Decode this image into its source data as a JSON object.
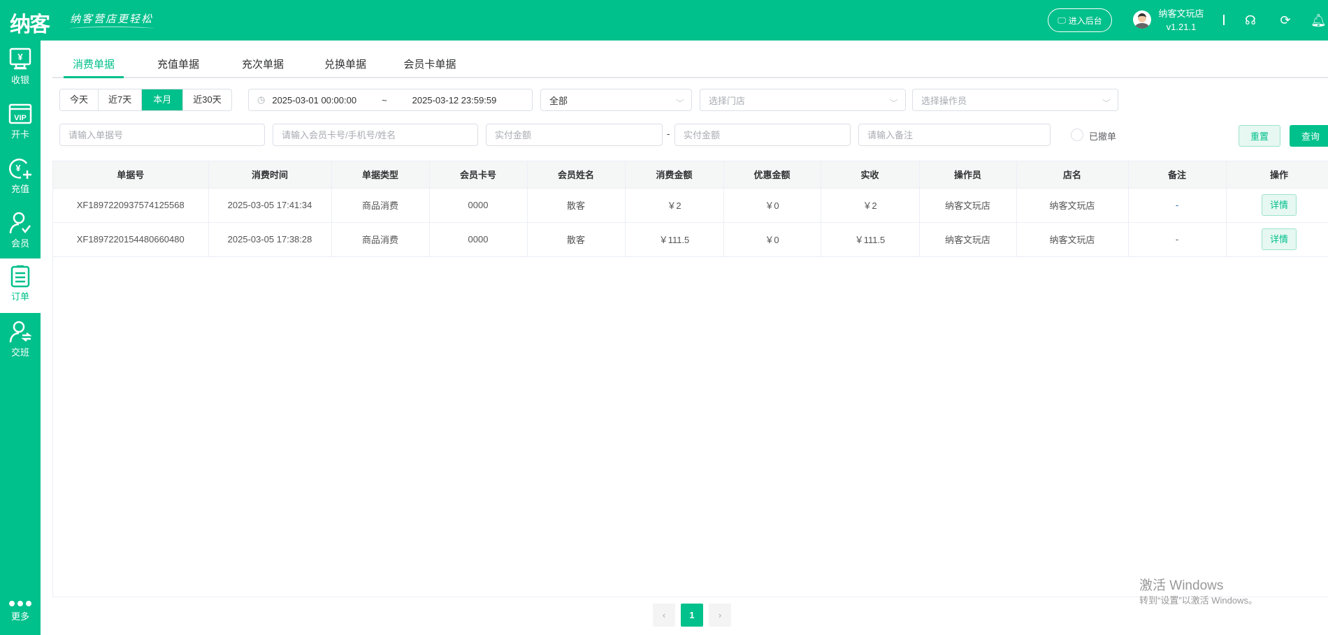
{
  "header": {
    "logo": "纳客",
    "slogan": "纳客营店更轻松",
    "backend_button": "进入后台",
    "store_name": "纳客文玩店",
    "version": "v1.21.1",
    "brand_color": "#00c08b"
  },
  "sidebar": {
    "items": [
      {
        "label": "收银",
        "icon": "cashier-icon"
      },
      {
        "label": "开卡",
        "icon": "vip-card-icon"
      },
      {
        "label": "充值",
        "icon": "recharge-icon"
      },
      {
        "label": "会员",
        "icon": "member-icon"
      },
      {
        "label": "订单",
        "icon": "order-icon",
        "active": true
      },
      {
        "label": "交班",
        "icon": "shift-handover-icon"
      }
    ],
    "more": "更多"
  },
  "tabs": [
    "消费单据",
    "充值单据",
    "充次单据",
    "兑换单据",
    "会员卡单据"
  ],
  "filters": {
    "quick_ranges": [
      "今天",
      "近7天",
      "本月",
      "近30天"
    ],
    "active_range": "本月",
    "date_start": "2025-03-01 00:00:00",
    "date_sep": "~",
    "date_end": "2025-03-12 23:59:59",
    "type_select": "全部",
    "store_placeholder": "选择门店",
    "operator_placeholder": "选择操作员",
    "order_no_placeholder": "请输入单据号",
    "member_placeholder": "请输入会员卡号/手机号/姓名",
    "amount_min_placeholder": "实付金额",
    "amount_sep": "-",
    "amount_max_placeholder": "实付金额",
    "remark_placeholder": "请输入备注",
    "revoked_label": "已撤单",
    "reset": "重置",
    "query": "查询"
  },
  "table": {
    "columns": [
      "单据号",
      "消费时间",
      "单据类型",
      "会员卡号",
      "会员姓名",
      "消费金额",
      "优惠金额",
      "实收",
      "操作员",
      "店名",
      "备注",
      "操作"
    ],
    "rows": [
      [
        "XF1897220937574125568",
        "2025-03-05 17:41:34",
        "商品消费",
        "0000",
        "散客",
        "￥2",
        "￥0",
        "￥2",
        "纳客文玩店",
        "纳客文玩店",
        "-",
        "详情"
      ],
      [
        "XF1897220154480660480",
        "2025-03-05 17:38:28",
        "商品消费",
        "0000",
        "散客",
        "￥111.5",
        "￥0",
        "￥111.5",
        "纳客文玩店",
        "纳客文玩店",
        "-",
        "详情"
      ]
    ]
  },
  "pagination": {
    "prev": "‹",
    "current": "1",
    "next": "›"
  },
  "watermark": {
    "line1": "激活 Windows",
    "line2": "转到“设置”以激活 Windows。"
  }
}
